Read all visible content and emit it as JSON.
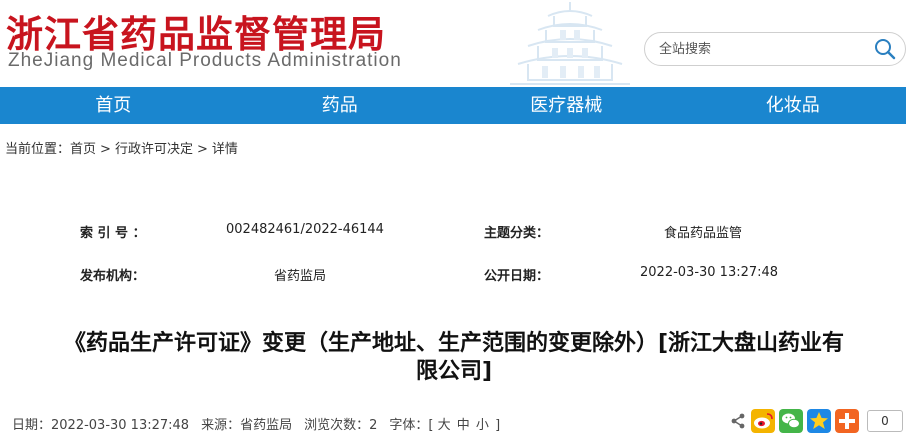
{
  "header": {
    "site_name": "浙江省药品监督管理局",
    "site_name_en": "ZheJiang Medical Products Administration",
    "search": {
      "placeholder": "全站搜索"
    }
  },
  "nav": {
    "items": [
      {
        "label": "首页"
      },
      {
        "label": "药品"
      },
      {
        "label": "医疗器械"
      },
      {
        "label": "化妆品"
      }
    ]
  },
  "breadcrumb": {
    "prefix": "当前位置：",
    "items": [
      "首页",
      "行政许可决定",
      "详情"
    ],
    "separator": ">"
  },
  "info": {
    "index_label": "索 引 号 ：",
    "index_value": "002482461/2022-46144",
    "topic_label": "主题分类：",
    "topic_value": "食品药品监管",
    "publisher_label": "发布机构：",
    "publisher_value": "省药监局",
    "date_label": "公开日期：",
    "date_value": "2022-03-30 13:27:48"
  },
  "article": {
    "title_line1": "《药品生产许可证》变更（生产地址、生产范围的变更除外）[浙江大盘山药业有",
    "title_line2": "限公司]"
  },
  "meta": {
    "date": "日期：2022-03-30 13:27:48",
    "source": "来源：省药监局",
    "views": "浏览次数：2",
    "font_label": "字体：[",
    "font_large": "大",
    "font_medium": "中",
    "font_small": "小",
    "font_end": "]"
  },
  "share": {
    "count": "0"
  },
  "colors": {
    "brand_red": "#c8141e",
    "nav_blue": "#1a86cf"
  }
}
